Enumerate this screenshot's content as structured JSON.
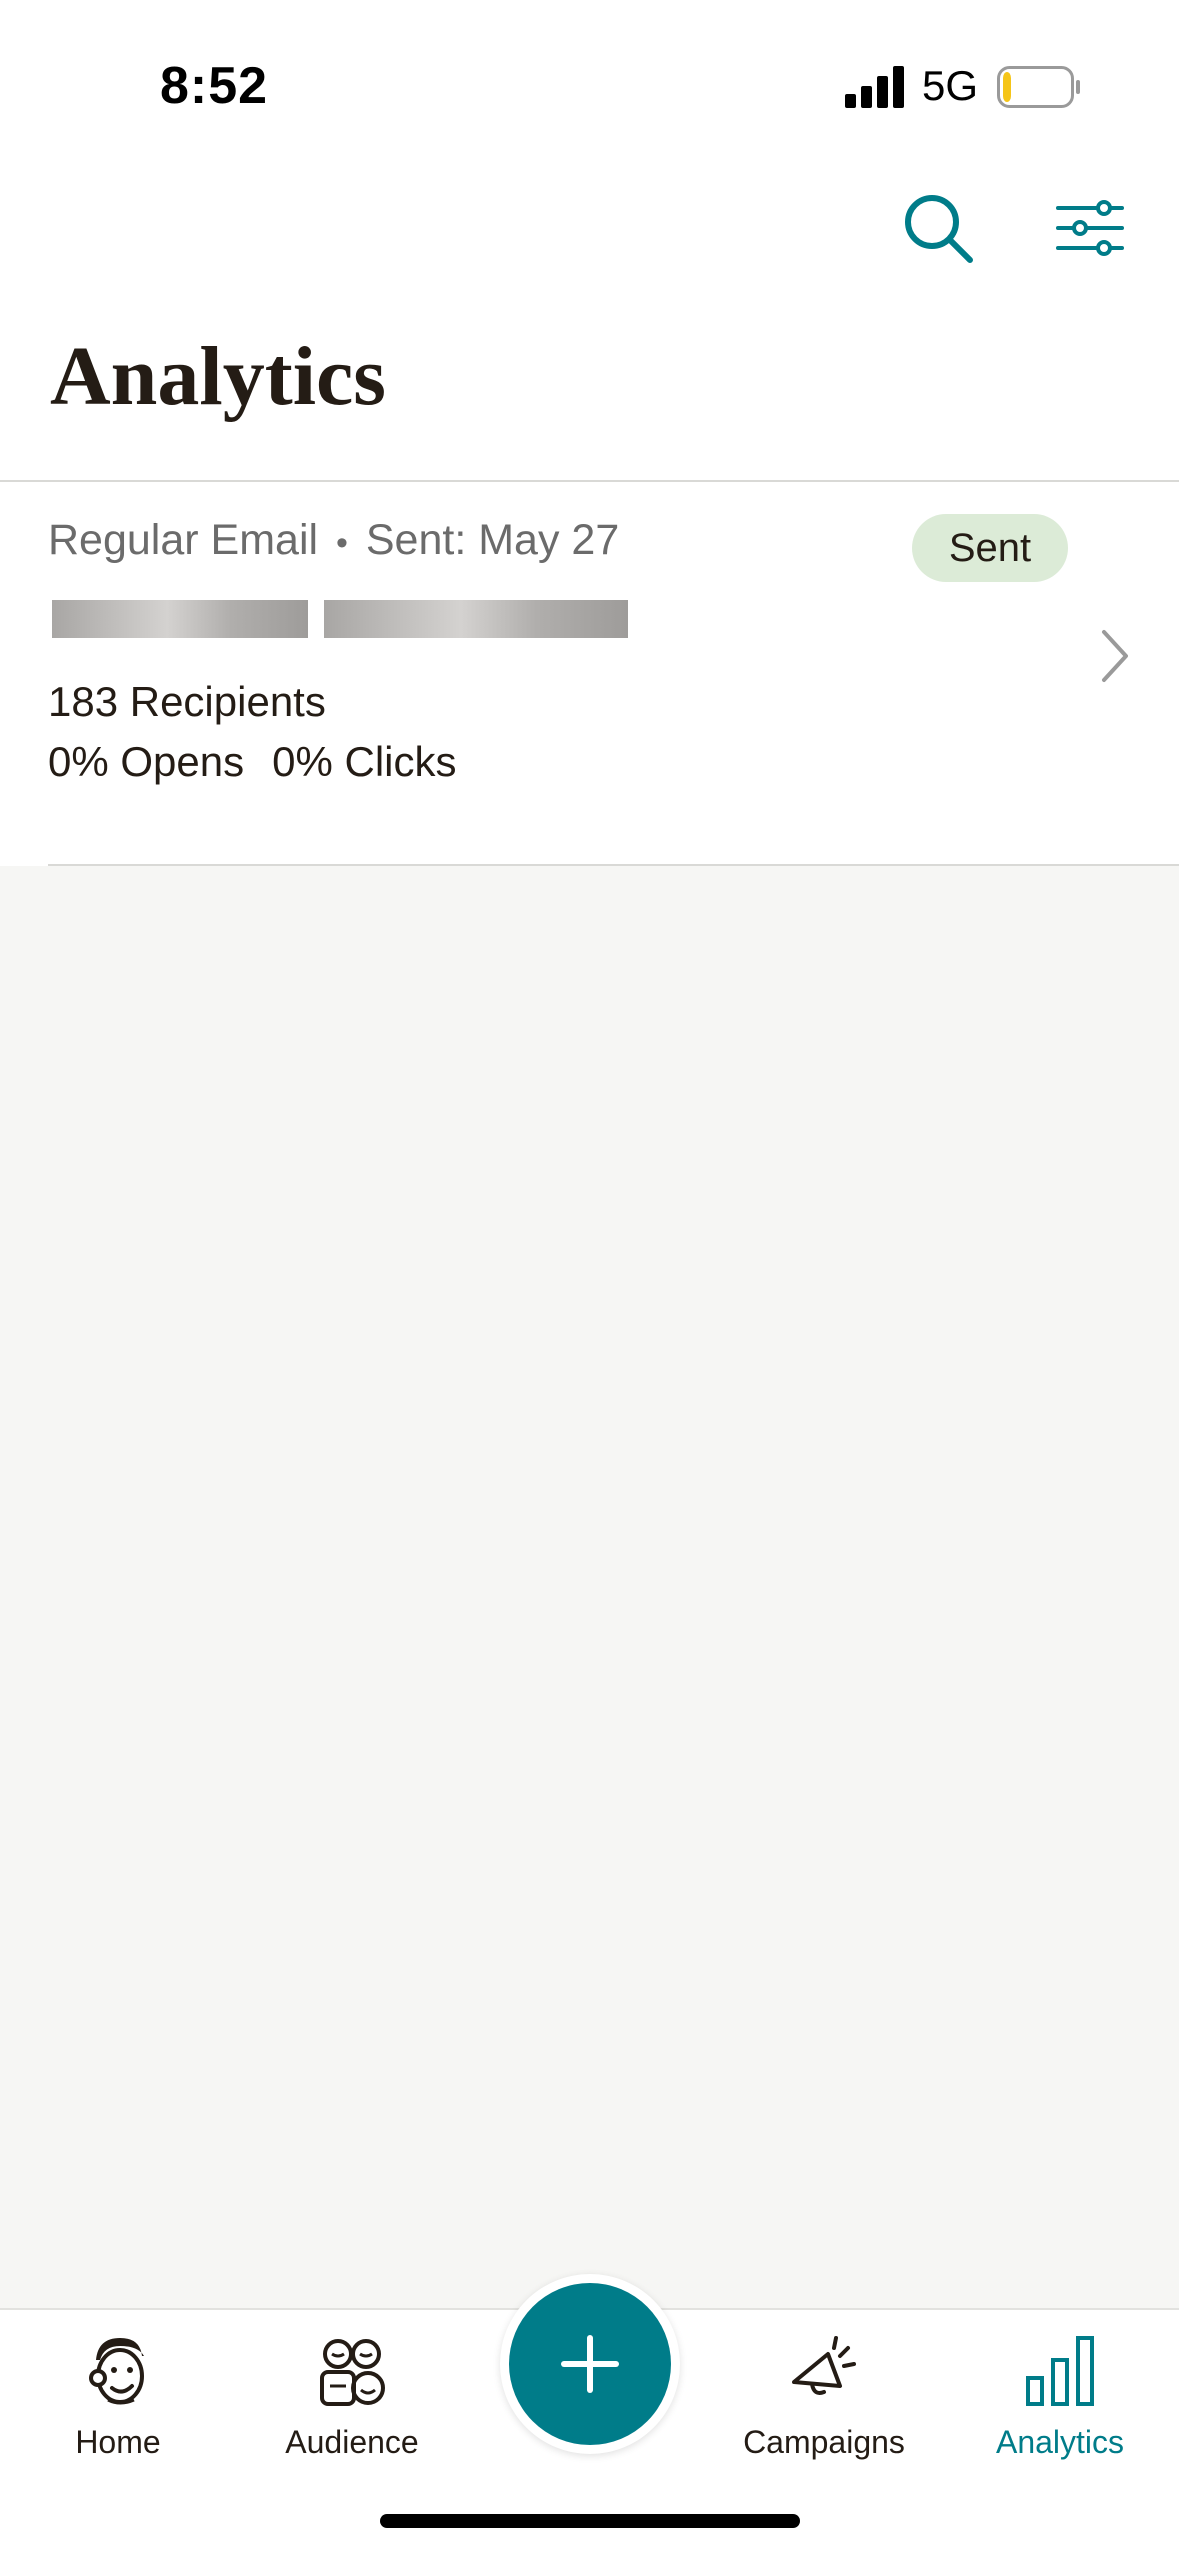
{
  "status_bar": {
    "time": "8:52",
    "network": "5G",
    "battery_level": 0.12,
    "battery_color": "#f5c518"
  },
  "header": {
    "title": "Analytics",
    "search_icon": "search-icon",
    "filter_icon": "sliders-icon",
    "accent_color": "#007c89"
  },
  "campaigns": [
    {
      "type": "Regular Email",
      "sent_date": "Sent: May 27",
      "separator": "•",
      "status": "Sent",
      "recipients": "183 Recipients",
      "opens": "0% Opens",
      "clicks": "0% Clicks"
    }
  ],
  "nav": {
    "items": [
      {
        "label": "Home",
        "icon": "freddie-icon"
      },
      {
        "label": "Audience",
        "icon": "audience-icon"
      },
      {
        "label": "Campaigns",
        "icon": "megaphone-icon"
      },
      {
        "label": "Analytics",
        "icon": "bar-chart-icon",
        "active": true
      }
    ],
    "create_icon": "plus-icon"
  }
}
